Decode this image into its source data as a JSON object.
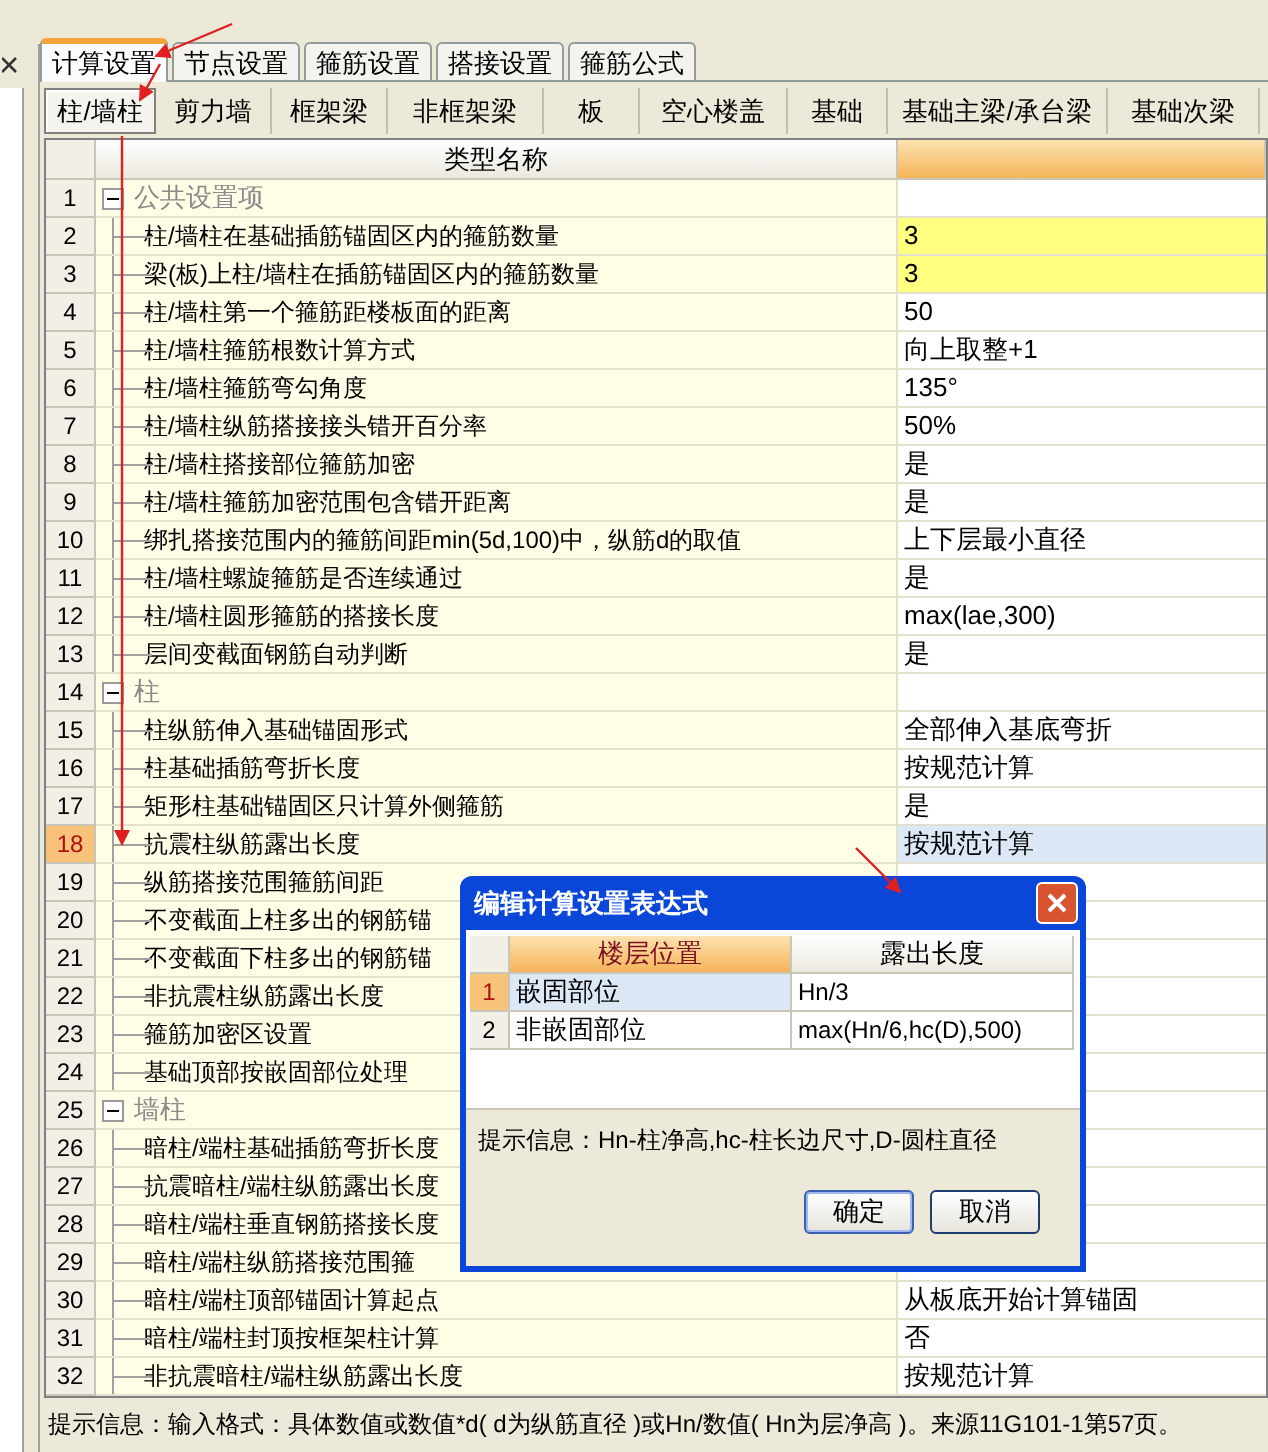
{
  "tabs": [
    {
      "label": "计算设置",
      "selected": true
    },
    {
      "label": "节点设置",
      "selected": false
    },
    {
      "label": "箍筋设置",
      "selected": false
    },
    {
      "label": "搭接设置",
      "selected": false
    },
    {
      "label": "箍筋公式",
      "selected": false
    }
  ],
  "subtabs": [
    {
      "label": "柱/墙柱",
      "selected": true
    },
    {
      "label": "剪力墙",
      "selected": false
    },
    {
      "label": "框架梁",
      "selected": false
    },
    {
      "label": "非框架梁",
      "selected": false
    },
    {
      "label": "板",
      "selected": false
    },
    {
      "label": "空心楼盖",
      "selected": false
    },
    {
      "label": "基础",
      "selected": false
    },
    {
      "label": "基础主梁/承台梁",
      "selected": false
    },
    {
      "label": "基础次梁",
      "selected": false
    }
  ],
  "table": {
    "columns": [
      {
        "label": "类型名称",
        "selected": false
      },
      {
        "selected": true
      }
    ],
    "rows": [
      {
        "number": "1",
        "name": "公共设置项",
        "expanded": true,
        "children": [
          {
            "number": "2",
            "name": "柱/墙柱在基础插筋锚固区内的箍筋数量",
            "value": "3",
            "highlighted": true,
            "selected": false
          },
          {
            "number": "3",
            "name": "梁(板)上柱/墙柱在插筋锚固区内的箍筋数量",
            "value": "3",
            "highlighted": true,
            "selected": false
          },
          {
            "number": "4",
            "name": "柱/墙柱第一个箍筋距楼板面的距离",
            "value": "50",
            "highlighted": false,
            "selected": false
          },
          {
            "number": "5",
            "name": "柱/墙柱箍筋根数计算方式",
            "value": "向上取整+1",
            "highlighted": false,
            "selected": false
          },
          {
            "number": "6",
            "name": "柱/墙柱箍筋弯勾角度",
            "value": "135°",
            "highlighted": false,
            "selected": false
          },
          {
            "number": "7",
            "name": "柱/墙柱纵筋搭接接头错开百分率",
            "value": "50%",
            "highlighted": false,
            "selected": false
          },
          {
            "number": "8",
            "name": "柱/墙柱搭接部位箍筋加密",
            "value": "是",
            "highlighted": false,
            "selected": false
          },
          {
            "number": "9",
            "name": "柱/墙柱箍筋加密范围包含错开距离",
            "value": "是",
            "highlighted": false,
            "selected": false
          },
          {
            "number": "10",
            "name": "绑扎搭接范围内的箍筋间距min(5d,100)中，纵筋d的取值",
            "value": "上下层最小直径",
            "highlighted": false,
            "selected": false
          },
          {
            "number": "11",
            "name": "柱/墙柱螺旋箍筋是否连续通过",
            "value": "是",
            "highlighted": false,
            "selected": false
          },
          {
            "number": "12",
            "name": "柱/墙柱圆形箍筋的搭接长度",
            "value": "max(lae,300)",
            "highlighted": false,
            "selected": false
          },
          {
            "number": "13",
            "name": "层间变截面钢筋自动判断",
            "value": "是",
            "highlighted": false,
            "selected": false
          }
        ]
      },
      {
        "number": "14",
        "name": "柱",
        "expanded": true,
        "children": [
          {
            "number": "15",
            "name": "柱纵筋伸入基础锚固形式",
            "value": "全部伸入基底弯折",
            "highlighted": false,
            "selected": false
          },
          {
            "number": "16",
            "name": "柱基础插筋弯折长度",
            "value": "按规范计算",
            "highlighted": false,
            "selected": false
          },
          {
            "number": "17",
            "name": "矩形柱基础锚固区只计算外侧箍筋",
            "value": "是",
            "highlighted": false,
            "selected": false
          },
          {
            "number": "18",
            "name": "抗震柱纵筋露出长度",
            "value": "按规范计算",
            "highlighted": false,
            "selected": true
          },
          {
            "number": "19",
            "name": "纵筋搭接范围箍筋间距",
            "selected": false
          },
          {
            "number": "20",
            "name": "不变截面上柱多出的钢筋锚",
            "selected": false
          },
          {
            "number": "21",
            "name": "不变截面下柱多出的钢筋锚",
            "selected": false
          },
          {
            "number": "22",
            "name": "非抗震柱纵筋露出长度",
            "selected": false
          },
          {
            "number": "23",
            "name": "箍筋加密区设置",
            "selected": false
          },
          {
            "number": "24",
            "name": "基础顶部按嵌固部位处理",
            "selected": false
          }
        ]
      },
      {
        "number": "25",
        "name": "墙柱",
        "expanded": true,
        "children": [
          {
            "number": "26",
            "name": "暗柱/端柱基础插筋弯折长度",
            "selected": false
          },
          {
            "number": "27",
            "name": "抗震暗柱/端柱纵筋露出长度",
            "selected": false
          },
          {
            "number": "28",
            "name": "暗柱/端柱垂直钢筋搭接长度",
            "selected": false
          },
          {
            "number": "29",
            "name": "暗柱/端柱纵筋搭接范围箍",
            "selected": false
          },
          {
            "number": "30",
            "name": "暗柱/端柱顶部锚固计算起点",
            "value": "从板底开始计算锚固",
            "highlighted": false,
            "selected": false
          },
          {
            "number": "31",
            "name": "暗柱/端柱封顶按框架柱计算",
            "value": "否",
            "highlighted": false,
            "selected": false
          },
          {
            "number": "32",
            "name": "非抗震暗柱/端柱纵筋露出长度",
            "value": "按规范计算",
            "highlighted": false,
            "selected": false
          }
        ]
      }
    ]
  },
  "dialog": {
    "title": "编辑计算设置表达式",
    "columns": [
      {
        "label": "楼层位置",
        "selected": true
      },
      {
        "label": "露出长度",
        "selected": false
      }
    ],
    "rows": [
      {
        "number": "1",
        "position": "嵌固部位",
        "value": "Hn/3",
        "selected": true
      },
      {
        "number": "2",
        "position": "非嵌固部位",
        "value": "max(Hn/6,hc(D),500)",
        "selected": false
      }
    ],
    "hint": "提示信息：Hn-柱净高,hc-柱长边尺寸,D-圆柱直径",
    "buttons": [
      {
        "label": "确定",
        "focused": true
      },
      {
        "label": "取消",
        "focused": false
      }
    ]
  },
  "status_bar": "提示信息：输入格式：具体数值或数值*d( d为纵筋直径 )或Hn/数值( Hn为层净高 )。来源11G101-1第57页。"
}
